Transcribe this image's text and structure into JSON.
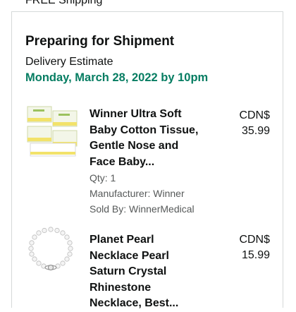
{
  "header": {
    "shipping_text": "FREE Shipping"
  },
  "shipment": {
    "status": "Preparing for Shipment",
    "estimate_label": "Delivery Estimate",
    "estimate_date": "Monday, March 28, 2022 by 10pm"
  },
  "items": [
    {
      "title_lines": [
        "Winner Ultra Soft",
        "Baby Cotton Tissue,",
        "Gentle Nose and",
        "Face Baby..."
      ],
      "qty": "Qty: 1",
      "manufacturer": "Manufacturer: Winner",
      "sold_by": "Sold By: WinnerMedical",
      "price_currency": "CDN$",
      "price_amount": "35.99",
      "thumbnail_icon": "tissue-boxes-icon"
    },
    {
      "title_lines": [
        "Planet Pearl",
        "Necklace Pearl",
        "Saturn Crystal",
        "Rhinestone",
        "Necklace, Best..."
      ],
      "price_currency": "CDN$",
      "price_amount": "15.99",
      "thumbnail_icon": "pearl-necklace-icon"
    }
  ],
  "colors": {
    "estimate_green": "#067d62",
    "border": "#d5d9d9",
    "meta_grey": "#565959"
  }
}
